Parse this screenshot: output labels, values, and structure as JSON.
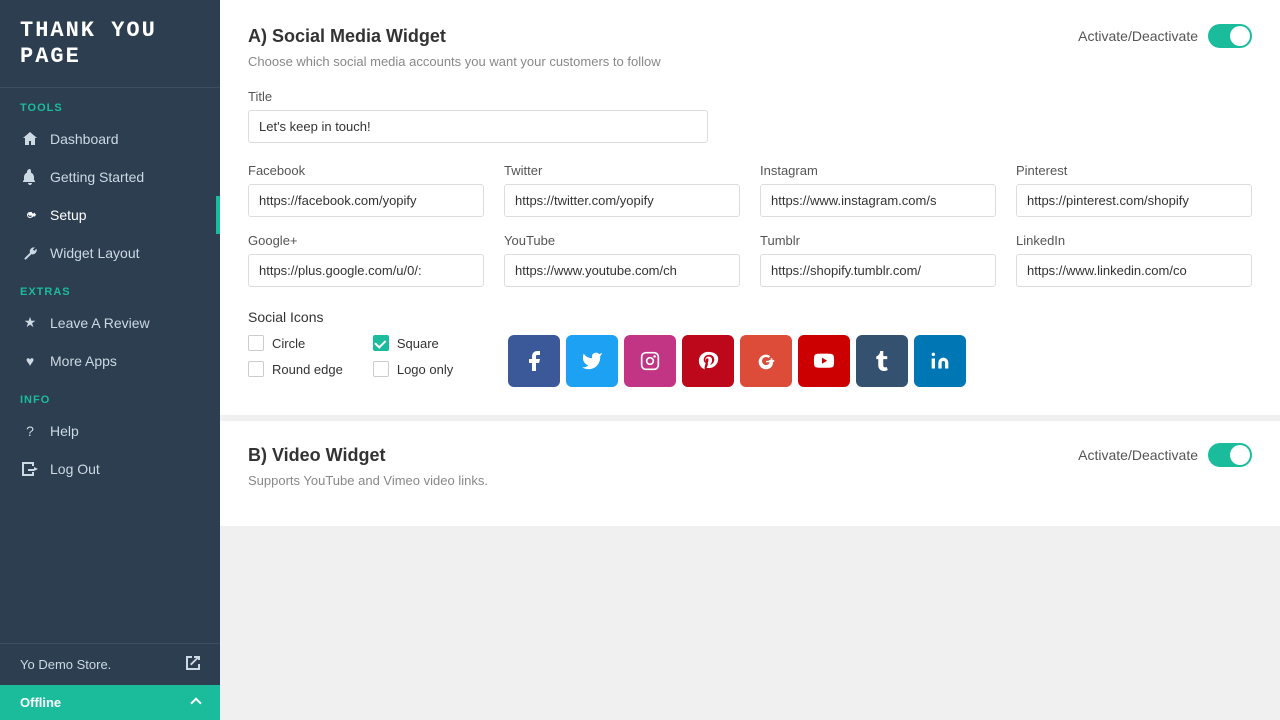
{
  "app": {
    "title": "THANK YOU PAGE",
    "store_name": "Yo Demo Store.",
    "offline_label": "Offline"
  },
  "sidebar": {
    "tools_label": "Tools",
    "extras_label": "Extras",
    "info_label": "Info",
    "items": [
      {
        "id": "dashboard",
        "label": "Dashboard",
        "icon": "🏠"
      },
      {
        "id": "getting-started",
        "label": "Getting Started",
        "icon": "🔔"
      },
      {
        "id": "setup",
        "label": "Setup",
        "icon": "⚙️",
        "active": true
      },
      {
        "id": "widget-layout",
        "label": "Widget Layout",
        "icon": "🔧"
      },
      {
        "id": "leave-review",
        "label": "Leave A Review",
        "icon": "★"
      },
      {
        "id": "more-apps",
        "label": "More Apps",
        "icon": "♥"
      },
      {
        "id": "help",
        "label": "Help",
        "icon": "?"
      },
      {
        "id": "logout",
        "label": "Log Out",
        "icon": "↩"
      }
    ]
  },
  "social_widget": {
    "section_label": "A) Social Media Widget",
    "description": "Choose which social media accounts you want your customers to follow",
    "activate_label": "Activate/Deactivate",
    "title_label": "Title",
    "title_value": "Let's keep in touch!",
    "facebook_label": "Facebook",
    "facebook_value": "https://facebook.com/yopify",
    "twitter_label": "Twitter",
    "twitter_value": "https://twitter.com/yopify",
    "instagram_label": "Instagram",
    "instagram_value": "https://www.instagram.com/s",
    "pinterest_label": "Pinterest",
    "pinterest_value": "https://pinterest.com/shopify",
    "googleplus_label": "Google+",
    "googleplus_value": "https://plus.google.com/u/0/:",
    "youtube_label": "YouTube",
    "youtube_value": "https://www.youtube.com/ch",
    "tumblr_label": "Tumblr",
    "tumblr_value": "https://shopify.tumblr.com/",
    "linkedin_label": "LinkedIn",
    "linkedin_value": "https://www.linkedin.com/co",
    "social_icons_label": "Social Icons",
    "option_circle": "Circle",
    "option_round_edge": "Round edge",
    "option_square": "Square",
    "option_logo_only": "Logo only"
  },
  "video_widget": {
    "section_label": "B) Video Widget",
    "description": "Supports YouTube and Vimeo video links.",
    "activate_label": "Activate/Deactivate"
  },
  "social_icons": [
    {
      "label": "f",
      "color": "#3b5998",
      "name": "facebook"
    },
    {
      "label": "t",
      "color": "#1da1f2",
      "name": "twitter"
    },
    {
      "label": "📷",
      "color": "#c13584",
      "name": "instagram"
    },
    {
      "label": "p",
      "color": "#bd081c",
      "name": "pinterest"
    },
    {
      "label": "g+",
      "color": "#dd4b39",
      "name": "googleplus"
    },
    {
      "label": "▶",
      "color": "#cc0000",
      "name": "youtube"
    },
    {
      "label": "t",
      "color": "#34526f",
      "name": "tumblr"
    },
    {
      "label": "in",
      "color": "#0077b5",
      "name": "linkedin"
    }
  ]
}
